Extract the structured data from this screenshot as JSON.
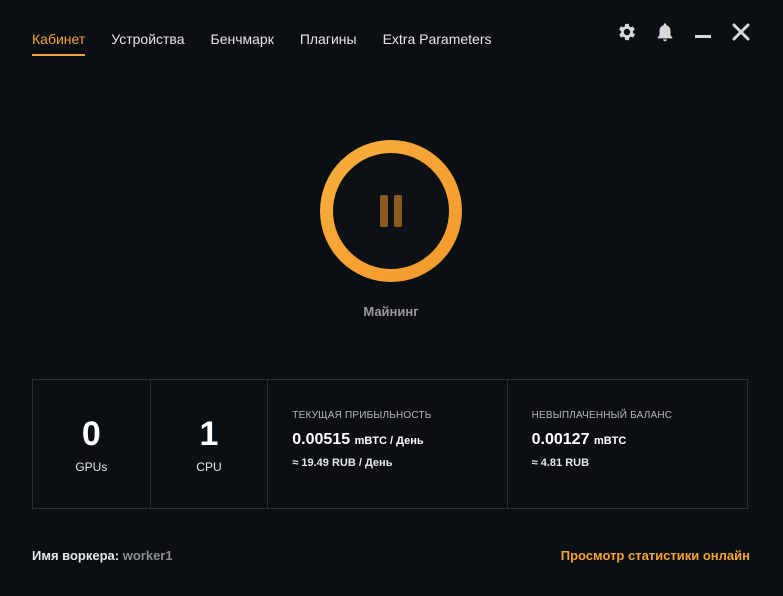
{
  "nav": {
    "tabs": [
      {
        "label": "Кабинет",
        "active": true
      },
      {
        "label": "Устройства",
        "active": false
      },
      {
        "label": "Бенчмарк",
        "active": false
      },
      {
        "label": "Плагины",
        "active": false
      },
      {
        "label": "Extra Parameters",
        "active": false
      }
    ]
  },
  "window_controls": {
    "icons": [
      "gear-icon",
      "bell-icon",
      "minimize-icon",
      "close-icon"
    ]
  },
  "mining": {
    "label": "Майнинг",
    "state": "paused",
    "icon": "pause-icon"
  },
  "stats": {
    "gpus": {
      "value": "0",
      "label": "GPUs"
    },
    "cpu": {
      "value": "1",
      "label": "CPU"
    },
    "profitability": {
      "caption": "ТЕКУЩАЯ ПРИБЫЛЬНОСТЬ",
      "value": "0.00515",
      "unit": "mBTC / День",
      "fiat": "≈ 19.49 RUB / День"
    },
    "balance": {
      "caption": "НЕВЫПЛАЧЕННЫЙ БАЛАНС",
      "value": "0.00127",
      "unit": "mBTC",
      "fiat": "≈ 4.81 RUB"
    }
  },
  "footer": {
    "worker_label": "Имя воркера:",
    "worker_name": "worker1",
    "stats_link": "Просмотр статистики онлайн"
  },
  "colors": {
    "accent": "#f7a234",
    "background": "#0a0f14",
    "border": "#2a2f35"
  }
}
